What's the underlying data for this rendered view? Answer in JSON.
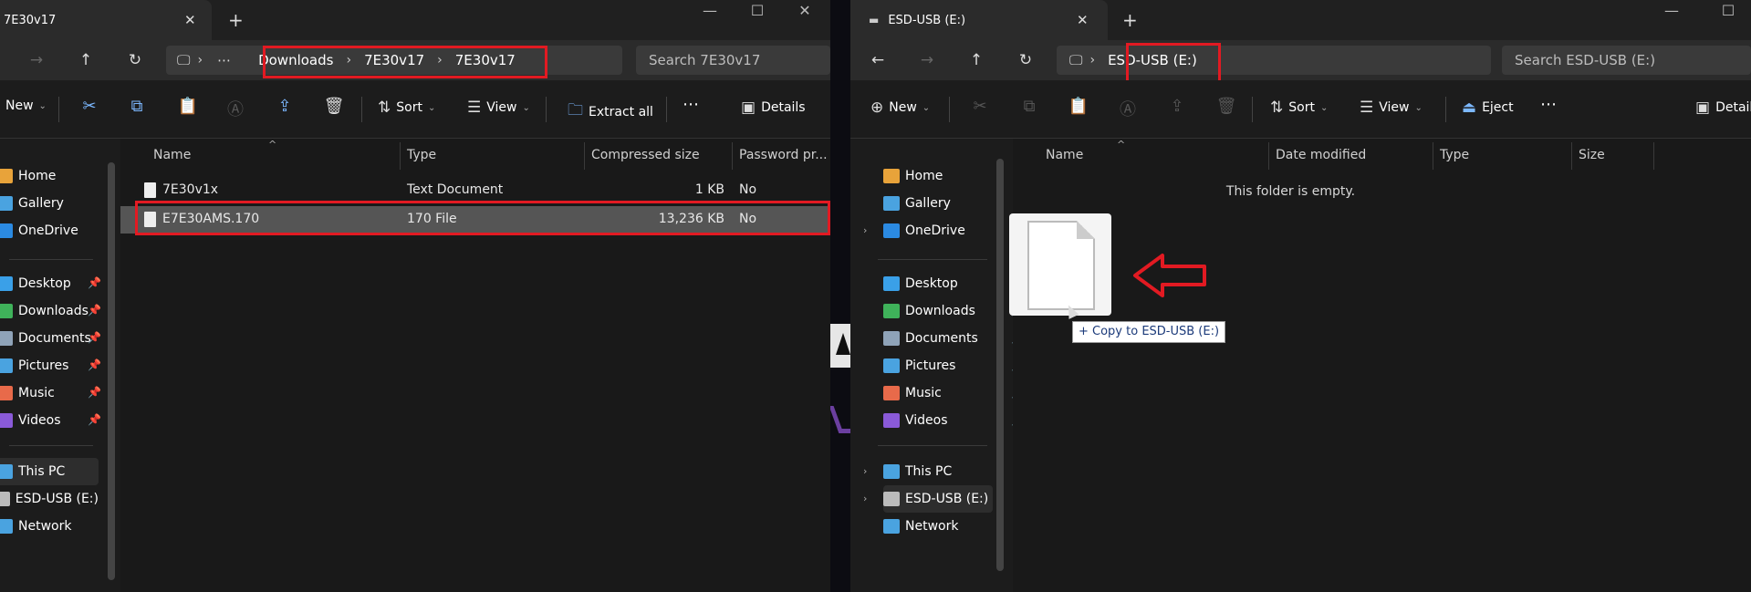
{
  "left_window": {
    "tab_title": "7E30v17",
    "address": {
      "crumbs": [
        "Downloads",
        "7E30v17",
        "7E30v17"
      ]
    },
    "search_placeholder": "Search 7E30v17",
    "commands": {
      "new": "New",
      "sort": "Sort",
      "view": "View",
      "extract_all": "Extract all",
      "details": "Details"
    },
    "sidebar": {
      "items": [
        {
          "label": "Home",
          "color": "#e8a33a"
        },
        {
          "label": "Gallery",
          "color": "#4aa3e0"
        },
        {
          "label": "OneDrive",
          "color": "#2b8ae2"
        },
        {
          "label": "Desktop",
          "color": "#3aa0e8"
        },
        {
          "label": "Downloads",
          "color": "#3fb25a"
        },
        {
          "label": "Documents",
          "color": "#8fa3b8"
        },
        {
          "label": "Pictures",
          "color": "#4aa3e0"
        },
        {
          "label": "Music",
          "color": "#e86a4a"
        },
        {
          "label": "Videos",
          "color": "#8a5ad8"
        },
        {
          "label": "This PC",
          "color": "#4aa3e0"
        },
        {
          "label": "ESD-USB (E:)",
          "color": "#bbbbbb"
        },
        {
          "label": "Network",
          "color": "#4aa3e0"
        }
      ]
    },
    "columns": [
      "Name",
      "Type",
      "Compressed size",
      "Password pr..."
    ],
    "rows": [
      {
        "name": "7E30v1x",
        "type": "Text Document",
        "size": "1 KB",
        "password": "No"
      },
      {
        "name": "E7E30AMS.170",
        "type": "170 File",
        "size": "13,236 KB",
        "password": "No"
      }
    ]
  },
  "right_window": {
    "tab_title": "ESD-USB (E:)",
    "address": {
      "crumbs": [
        "ESD-USB (E:)"
      ]
    },
    "search_placeholder": "Search ESD-USB (E:)",
    "commands": {
      "new": "New",
      "sort": "Sort",
      "view": "View",
      "eject": "Eject",
      "details": "Details"
    },
    "sidebar": {
      "items": [
        {
          "label": "Home",
          "color": "#e8a33a"
        },
        {
          "label": "Gallery",
          "color": "#4aa3e0"
        },
        {
          "label": "OneDrive",
          "color": "#2b8ae2"
        },
        {
          "label": "Desktop",
          "color": "#3aa0e8"
        },
        {
          "label": "Downloads",
          "color": "#3fb25a"
        },
        {
          "label": "Documents",
          "color": "#8fa3b8"
        },
        {
          "label": "Pictures",
          "color": "#4aa3e0"
        },
        {
          "label": "Music",
          "color": "#e86a4a"
        },
        {
          "label": "Videos",
          "color": "#8a5ad8"
        },
        {
          "label": "This PC",
          "color": "#4aa3e0"
        },
        {
          "label": "ESD-USB (E:)",
          "color": "#bbbbbb"
        },
        {
          "label": "Network",
          "color": "#4aa3e0"
        }
      ]
    },
    "columns": [
      "Name",
      "Date modified",
      "Type",
      "Size"
    ],
    "empty_message": "This folder is empty.",
    "drag_tooltip": "+ Copy to ESD-USB (E:)"
  },
  "colors": {
    "highlight_red": "#e21a22",
    "accent_blue": "#7cb8ff"
  }
}
